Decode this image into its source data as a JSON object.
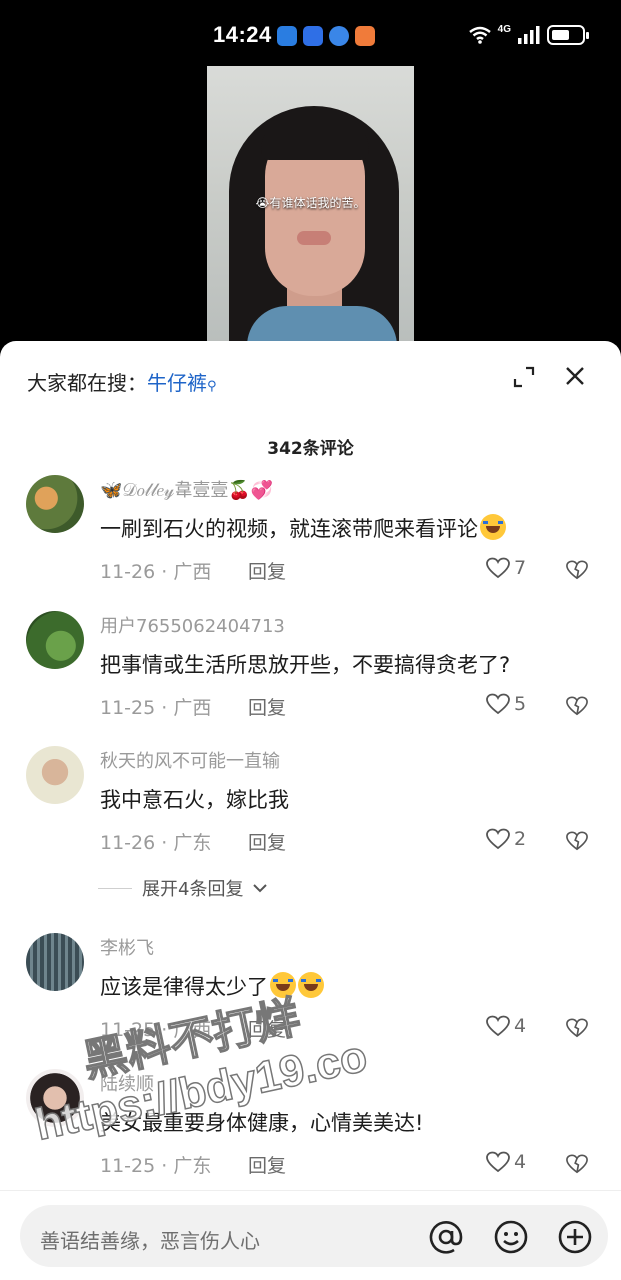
{
  "status_bar": {
    "time": "14:24",
    "network": "4G",
    "battery_level": 0.6
  },
  "video": {
    "caption": "😭有谁体话我的苦。"
  },
  "search_hint": {
    "label": "大家都在搜：",
    "term": "牛仔裤",
    "icon": "search-icon"
  },
  "comments_count": "342条评论",
  "comments": [
    {
      "user": "🦋𝒟𝑜𝓁𝓁𝑒𝓎韋壹壹🍒💞",
      "text": "一刷到石火的视频，就连滚带爬来看评论",
      "emoji": "😂",
      "date": "11-26 · 广西",
      "reply": "回复",
      "likes": "7"
    },
    {
      "user": "用户7655062404713",
      "text": "把事情或生活所思放开些，不要搞得贪老了?",
      "emoji": "",
      "date": "11-25 · 广西",
      "reply": "回复",
      "likes": "5"
    },
    {
      "user": "秋天的风不可能一直输",
      "text": "我中意石火，嫁比我",
      "emoji": "",
      "date": "11-26 · 广东",
      "reply": "回复",
      "likes": "2"
    },
    {
      "user": "李彬飞",
      "text": "应该是律得太少了",
      "emoji": "🤣🤣",
      "date": "11-25 · 广西",
      "reply": "回复",
      "likes": "4"
    },
    {
      "user": "陆续顺",
      "text": "美女最重要身体健康，心情美美达!",
      "emoji": "",
      "date": "11-25 · 广东",
      "reply": "回复",
      "likes": "4"
    }
  ],
  "expand_replies": "展开4条回复",
  "input": {
    "placeholder": "善语结善缘，恶言伤人心"
  },
  "watermark": {
    "line1": "黑料不打烊",
    "line2": "https://bdy19.co"
  },
  "colors": {
    "link": "#1e64c8",
    "muted": "#9a9a9a"
  }
}
